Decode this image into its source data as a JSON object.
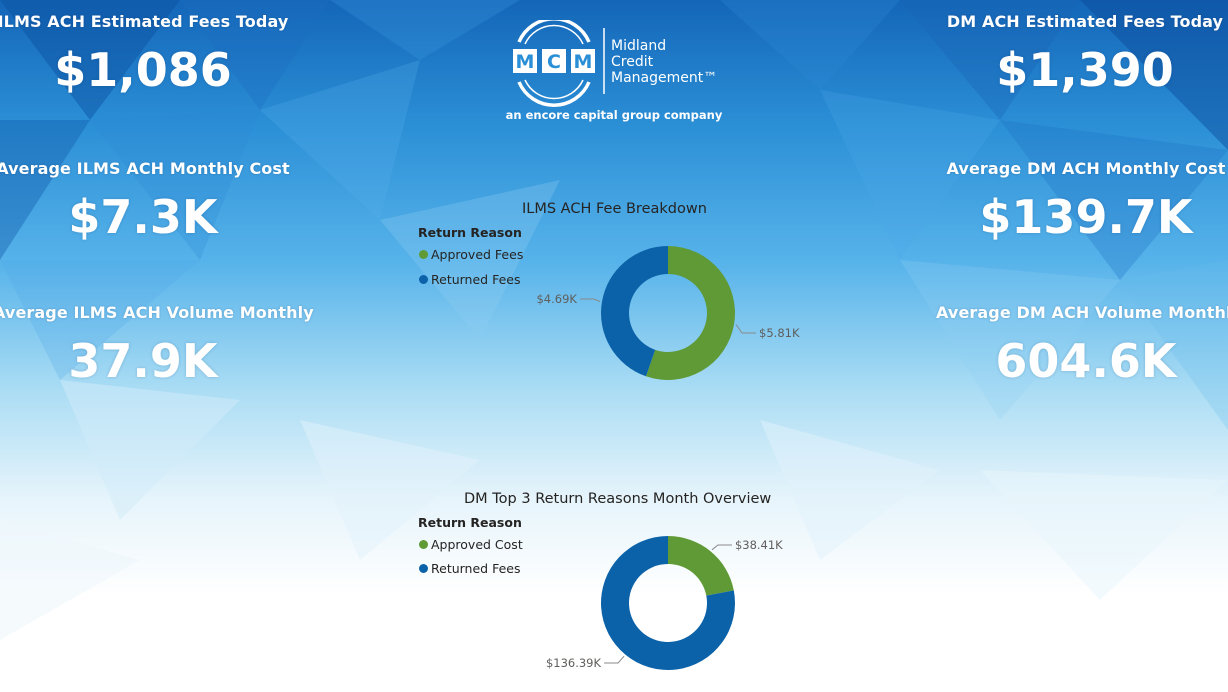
{
  "colors": {
    "approved": "#5f9a36",
    "returned": "#0c62a8",
    "kpi_text": "#ffffff"
  },
  "kpis": {
    "ilms_fees_today": {
      "label": "ILMS ACH Estimated Fees Today",
      "value": "$1,086"
    },
    "ilms_monthly_cost": {
      "label": "Average ILMS ACH Monthly Cost",
      "value": "$7.3K"
    },
    "ilms_volume_monthly": {
      "label": "Average ILMS ACH Volume Monthly",
      "value": "37.9K"
    },
    "dm_fees_today": {
      "label": "DM ACH Estimated Fees Today",
      "value": "$1,390"
    },
    "dm_monthly_cost": {
      "label": "Average DM ACH Monthly Cost",
      "value": "$139.7K"
    },
    "dm_volume_monthly": {
      "label": "Average DM ACH Volume Monthly",
      "value": "604.6K"
    }
  },
  "logo": {
    "monogram": "MCM",
    "name_lines": [
      "Midland",
      "Credit",
      "Management™"
    ],
    "tagline": "an encore capital group company"
  },
  "chart_data": [
    {
      "type": "pie",
      "donut": true,
      "title": "ILMS ACH Fee Breakdown",
      "legend_title": "Return Reason",
      "legend_position": "top-left",
      "series": [
        {
          "name": "Approved Fees",
          "value": 5.81,
          "label": "$5.81K",
          "color": "#5f9a36"
        },
        {
          "name": "Returned Fees",
          "value": 4.69,
          "label": "$4.69K",
          "color": "#0c62a8"
        }
      ]
    },
    {
      "type": "pie",
      "donut": true,
      "title": "DM Top 3 Return Reasons Month Overview",
      "legend_title": "Return Reason",
      "legend_position": "top-left",
      "series": [
        {
          "name": "Approved Cost",
          "value": 38.41,
          "label": "$38.41K",
          "color": "#5f9a36"
        },
        {
          "name": "Returned Fees",
          "value": 136.39,
          "label": "$136.39K",
          "color": "#0c62a8"
        }
      ]
    }
  ]
}
